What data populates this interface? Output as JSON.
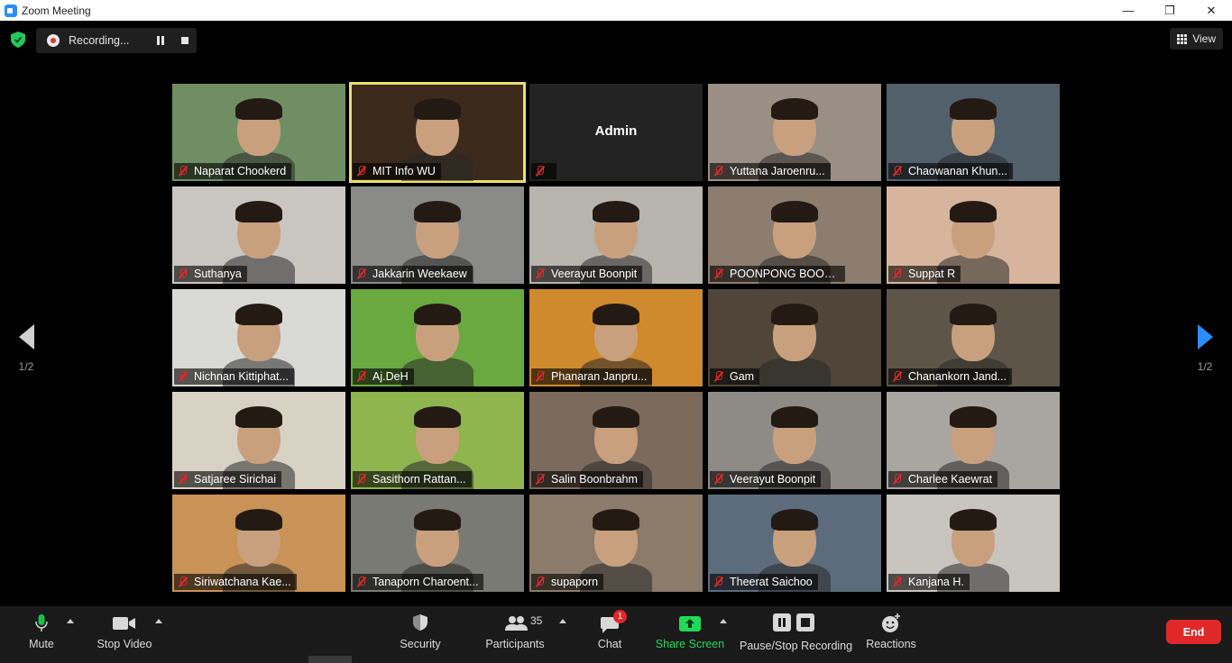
{
  "window": {
    "title": "Zoom Meeting",
    "minimize": "—",
    "restore": "❐",
    "close": "✕"
  },
  "recording": {
    "label": "Recording..."
  },
  "view": {
    "label": "View"
  },
  "paging": {
    "prev_label": "1/2",
    "next_label": "1/2"
  },
  "participants": [
    {
      "name": "Naparat Chookerd",
      "bg": "#6f8f63"
    },
    {
      "name": "MIT Info WU",
      "bg": "#3b2a1c",
      "active": true
    },
    {
      "name": "Admin",
      "bg": "#232323",
      "video_off": true
    },
    {
      "name": "Yuttana Jaroenru...",
      "bg": "#9a8f84"
    },
    {
      "name": "Chaowanan Khun...",
      "bg": "#51606a"
    },
    {
      "name": "Suthanya",
      "bg": "#c9c6c1"
    },
    {
      "name": "Jakkarin Weekaew",
      "bg": "#8a8a88"
    },
    {
      "name": "Veerayut Boonpit",
      "bg": "#b8b4ae"
    },
    {
      "name": "POONPONG BOON...",
      "bg": "#8c7d6e"
    },
    {
      "name": "Suppat R",
      "bg": "#d7b59c"
    },
    {
      "name": "Nichnan Kittiphat...",
      "bg": "#d9d9d6"
    },
    {
      "name": "Aj.DeH",
      "bg": "#6aa840"
    },
    {
      "name": "Phanaran Janpru...",
      "bg": "#cf8a2e"
    },
    {
      "name": "Gam",
      "bg": "#4f4538"
    },
    {
      "name": "Chanankorn Jand...",
      "bg": "#5d5547"
    },
    {
      "name": "Satjaree Sirichai",
      "bg": "#d8d2c5"
    },
    {
      "name": "Sasithorn Rattan...",
      "bg": "#8fb54f"
    },
    {
      "name": "Salin Boonbrahm",
      "bg": "#7c6a5c"
    },
    {
      "name": "Veerayut Boonpit",
      "bg": "#8e8b86"
    },
    {
      "name": "Charlee Kaewrat",
      "bg": "#a9a5a0"
    },
    {
      "name": "Siriwatchana Kae...",
      "bg": "#c99256"
    },
    {
      "name": "Tanaporn Charoent...",
      "bg": "#7a7a74"
    },
    {
      "name": "supaporn",
      "bg": "#8b7b6b"
    },
    {
      "name": "Theerat Saichoo",
      "bg": "#5c6c7c"
    },
    {
      "name": "Kanjana H.",
      "bg": "#c8c4be"
    }
  ],
  "toolbar": {
    "mute": "Mute",
    "stop_video": "Stop Video",
    "security": "Security",
    "participants": "Participants",
    "participants_count": "35",
    "chat": "Chat",
    "chat_badge": "1",
    "share_screen": "Share Screen",
    "pause_stop_recording": "Pause/Stop Recording",
    "reactions": "Reactions",
    "end": "End"
  },
  "colors": {
    "accent": "#2d8cff",
    "end": "#e02828",
    "share": "#23d959",
    "active_speaker": "#e8e06b",
    "muted": "#e02828"
  }
}
